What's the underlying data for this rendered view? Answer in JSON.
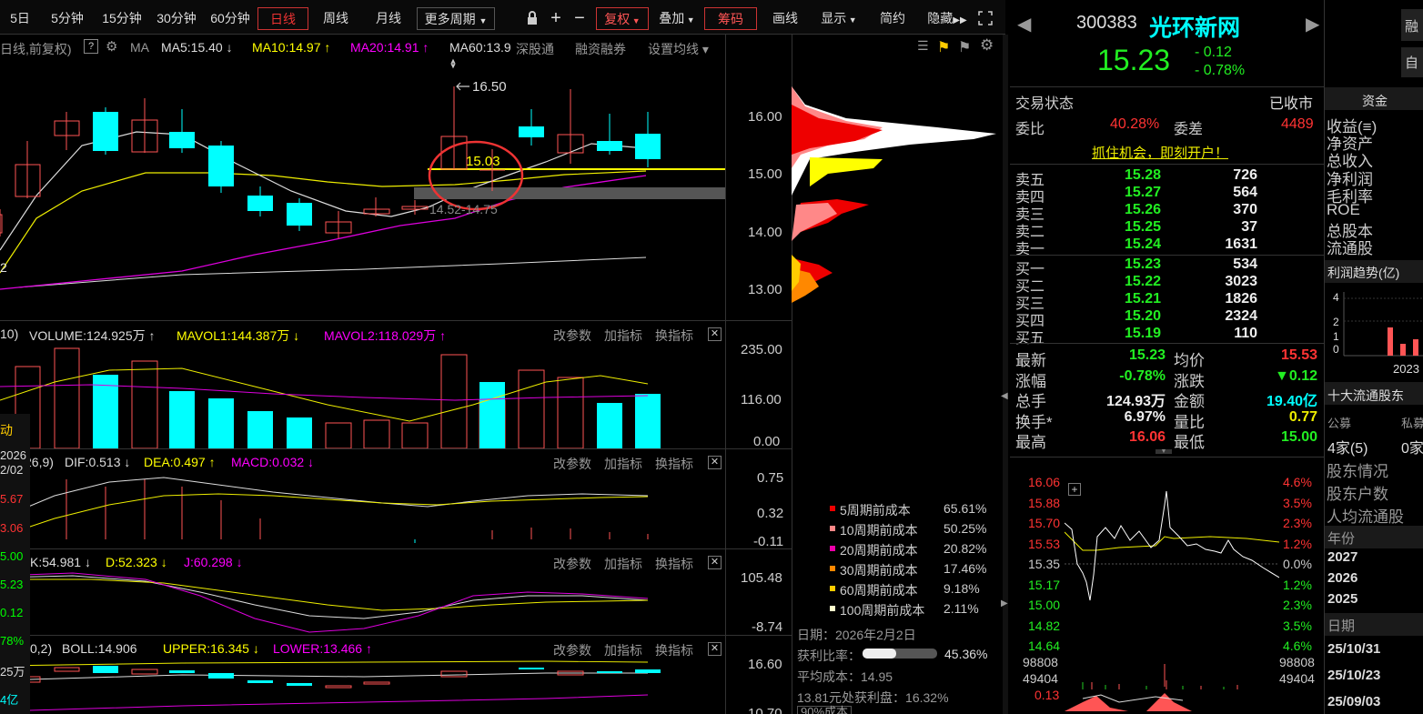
{
  "toolbar": {
    "items": [
      "5日",
      "5分钟",
      "15分钟",
      "30分钟",
      "60分钟",
      "日线",
      "周线",
      "月线",
      "更多周期",
      "复权",
      "叠加",
      "筹码",
      "画线",
      "显示",
      "简约",
      "隐藏"
    ],
    "active": "日线"
  },
  "main": {
    "title": "日线,前复权)",
    "ma_label": "MA",
    "ma5": "MA5:15.40",
    "ma10": "MA10:14.97",
    "ma20": "MA20:14.91",
    "ma60": "MA60:13.9",
    "shen": "深股通",
    "rongzi": "融资融券",
    "setma": "设置均线",
    "price_ticks": [
      "16.00",
      "15.00",
      "14.00",
      "13.00"
    ],
    "ann_high": "16.50",
    "ann_mid": "15.03",
    "ann_range": "14.52-14.75",
    "left_cut": "2"
  },
  "volume": {
    "prefix": "10)",
    "vol": "VOLUME:124.925万",
    "mavol1": "MAVOL1:144.387万",
    "mavol2": "MAVOL2:118.029万",
    "ticks": [
      "235.00",
      "116.00",
      "0.00"
    ]
  },
  "macd": {
    "prefix": "26,9)",
    "dif": "DIF:0.513",
    "dea": "DEA:0.497",
    "macd": "MACD:0.032",
    "ticks": [
      "0.75",
      "0.32",
      "-0.11"
    ]
  },
  "kdj": {
    "k": "K:54.981",
    "d": "D:52.323",
    "j": "J:60.298",
    "ticks": [
      "105.48",
      "-8.74"
    ]
  },
  "boll": {
    "prefix": "0,2)",
    "boll": "BOLL:14.906",
    "upper": "UPPER:16.345",
    "lower": "LOWER:13.466",
    "ticks": [
      "16.60",
      "10.70"
    ]
  },
  "panel_btns": {
    "a": "改参数",
    "b": "加指标",
    "c": "换指标"
  },
  "left_overlay": [
    "动",
    "2026",
    "2/02",
    "5.67",
    "3.06",
    "5.00",
    "5.23",
    "0.12",
    "78%",
    "25万",
    "4亿"
  ],
  "chips": {
    "legend": [
      [
        "5周期前成本",
        "65.61%"
      ],
      [
        "10周期前成本",
        "50.25%"
      ],
      [
        "20周期前成本",
        "20.82%"
      ],
      [
        "30周期前成本",
        "17.46%"
      ],
      [
        "60周期前成本",
        "9.18%"
      ],
      [
        "100周期前成本",
        "2.11%"
      ]
    ],
    "legend_colors": [
      "#e00",
      "#f88",
      "#e0a",
      "#f80",
      "#fc0",
      "#ffc"
    ],
    "date": "日期：2026年2月2日",
    "profit_label": "获利比率：",
    "profit": "45.36%",
    "profit_ratio": 0.4536,
    "avg": "平均成本：14.95",
    "note": "13.81元处获利盘：16.32%",
    "bottom": "90%成本"
  },
  "quote": {
    "code": "300383",
    "name": "光环新网",
    "price": "15.23",
    "chg": "- 0.12",
    "pct": "- 0.78%",
    "status_label": "交易状态",
    "status": "已收市",
    "wb_label": "委比",
    "wb": "40.28%",
    "wc_label": "委差",
    "wc": "4489",
    "promo": "抓住机会，即刻开户！",
    "sells": [
      [
        "卖五",
        "15.28",
        "726"
      ],
      [
        "卖四",
        "15.27",
        "564"
      ],
      [
        "卖三",
        "15.26",
        "370"
      ],
      [
        "卖二",
        "15.25",
        "37"
      ],
      [
        "卖一",
        "15.24",
        "1631"
      ]
    ],
    "buys": [
      [
        "买一",
        "15.23",
        "534"
      ],
      [
        "买二",
        "15.22",
        "3023"
      ],
      [
        "买三",
        "15.21",
        "1826"
      ],
      [
        "买四",
        "15.20",
        "2324"
      ],
      [
        "买五",
        "15.19",
        "110"
      ]
    ],
    "stats": [
      [
        "最新",
        "15.23",
        "均价",
        "15.53"
      ],
      [
        "涨幅",
        "-0.78%",
        "涨跌",
        "▼0.12"
      ],
      [
        "总手",
        "124.93万",
        "金额",
        "19.40亿"
      ],
      [
        "换手*",
        "6.97%",
        "量比",
        "0.77"
      ],
      [
        "最高",
        "16.06",
        "最低",
        "15.00"
      ]
    ]
  },
  "intraday": {
    "left": [
      "16.06",
      "15.88",
      "15.70",
      "15.53",
      "15.35",
      "15.17",
      "15.00",
      "14.82",
      "14.64"
    ],
    "right": [
      "4.6%",
      "3.5%",
      "2.3%",
      "1.2%",
      "0.0%",
      "1.2%",
      "2.3%",
      "3.5%",
      "4.6%"
    ],
    "vol": [
      "98808",
      "49404",
      "0.13"
    ],
    "vol_r": [
      "98808",
      "49404"
    ]
  },
  "fund": {
    "tab": "资金",
    "items": [
      "收益(≡)",
      "净资产",
      "总收入",
      "净利润",
      "毛利率",
      "ROE",
      "总股本",
      "流通股"
    ],
    "profit_trend": "利润趋势(亿)",
    "yticks": [
      "4",
      "2",
      "1",
      "0"
    ],
    "year": "2023",
    "top10": "十大流通股东",
    "fund_lbl": "公募",
    "private_lbl": "私募",
    "fund_val": "4家(5)",
    "private_val": "0家",
    "holder": "股东情况",
    "holders": "股东户数",
    "avg_hold": "人均流通股",
    "year_tab": "年份",
    "years": [
      "2027",
      "2026",
      "2025"
    ],
    "date_tab": "日期",
    "dates": [
      "25/10/31",
      "25/10/23",
      "25/09/03"
    ],
    "btn1": "融",
    "btn2": "自"
  }
}
